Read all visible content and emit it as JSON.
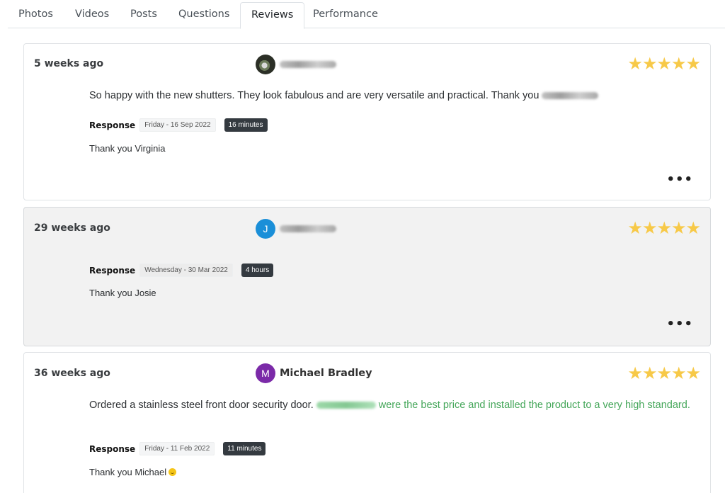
{
  "tabs": [
    {
      "label": "Photos"
    },
    {
      "label": "Videos"
    },
    {
      "label": "Posts"
    },
    {
      "label": "Questions"
    },
    {
      "label": "Reviews",
      "active": true
    },
    {
      "label": "Performance"
    }
  ],
  "reviews": [
    {
      "ago": "5 weeks ago",
      "author_avatar": "photo",
      "rating": 5,
      "stars": "★★★★★",
      "text": "So happy with the new shutters. They look fabulous and are very versatile and practical. Thank you",
      "response_label": "Response",
      "response_date": "Friday - 16 Sep 2022",
      "response_time": "16 minutes",
      "reply": "Thank you Virginia",
      "more": "•••"
    },
    {
      "ago": "29 weeks ago",
      "author_avatar": "J",
      "rating": 5,
      "stars": "★★★★★",
      "response_label": "Response",
      "response_date": "Wednesday - 30 Mar 2022",
      "response_time": "4 hours",
      "reply": "Thank you Josie",
      "more": "•••"
    },
    {
      "ago": "36 weeks ago",
      "author_avatar": "M",
      "author_name": "Michael Bradley",
      "rating": 5,
      "stars": "★★★★★",
      "text_start": "Ordered a stainless steel front door security door.",
      "text_highlight": "were the best price and installed the product to a very high standard.",
      "response_label": "Response",
      "response_date": "Friday - 11 Feb 2022",
      "response_time": "11 minutes",
      "reply": "Thank you Michael"
    }
  ],
  "colors": {
    "star": "#f7c948",
    "highlight": "#44a659",
    "time_badge": "#343a40",
    "avatar_blue": "#1a8fd8",
    "avatar_purple": "#7b2aa8"
  }
}
